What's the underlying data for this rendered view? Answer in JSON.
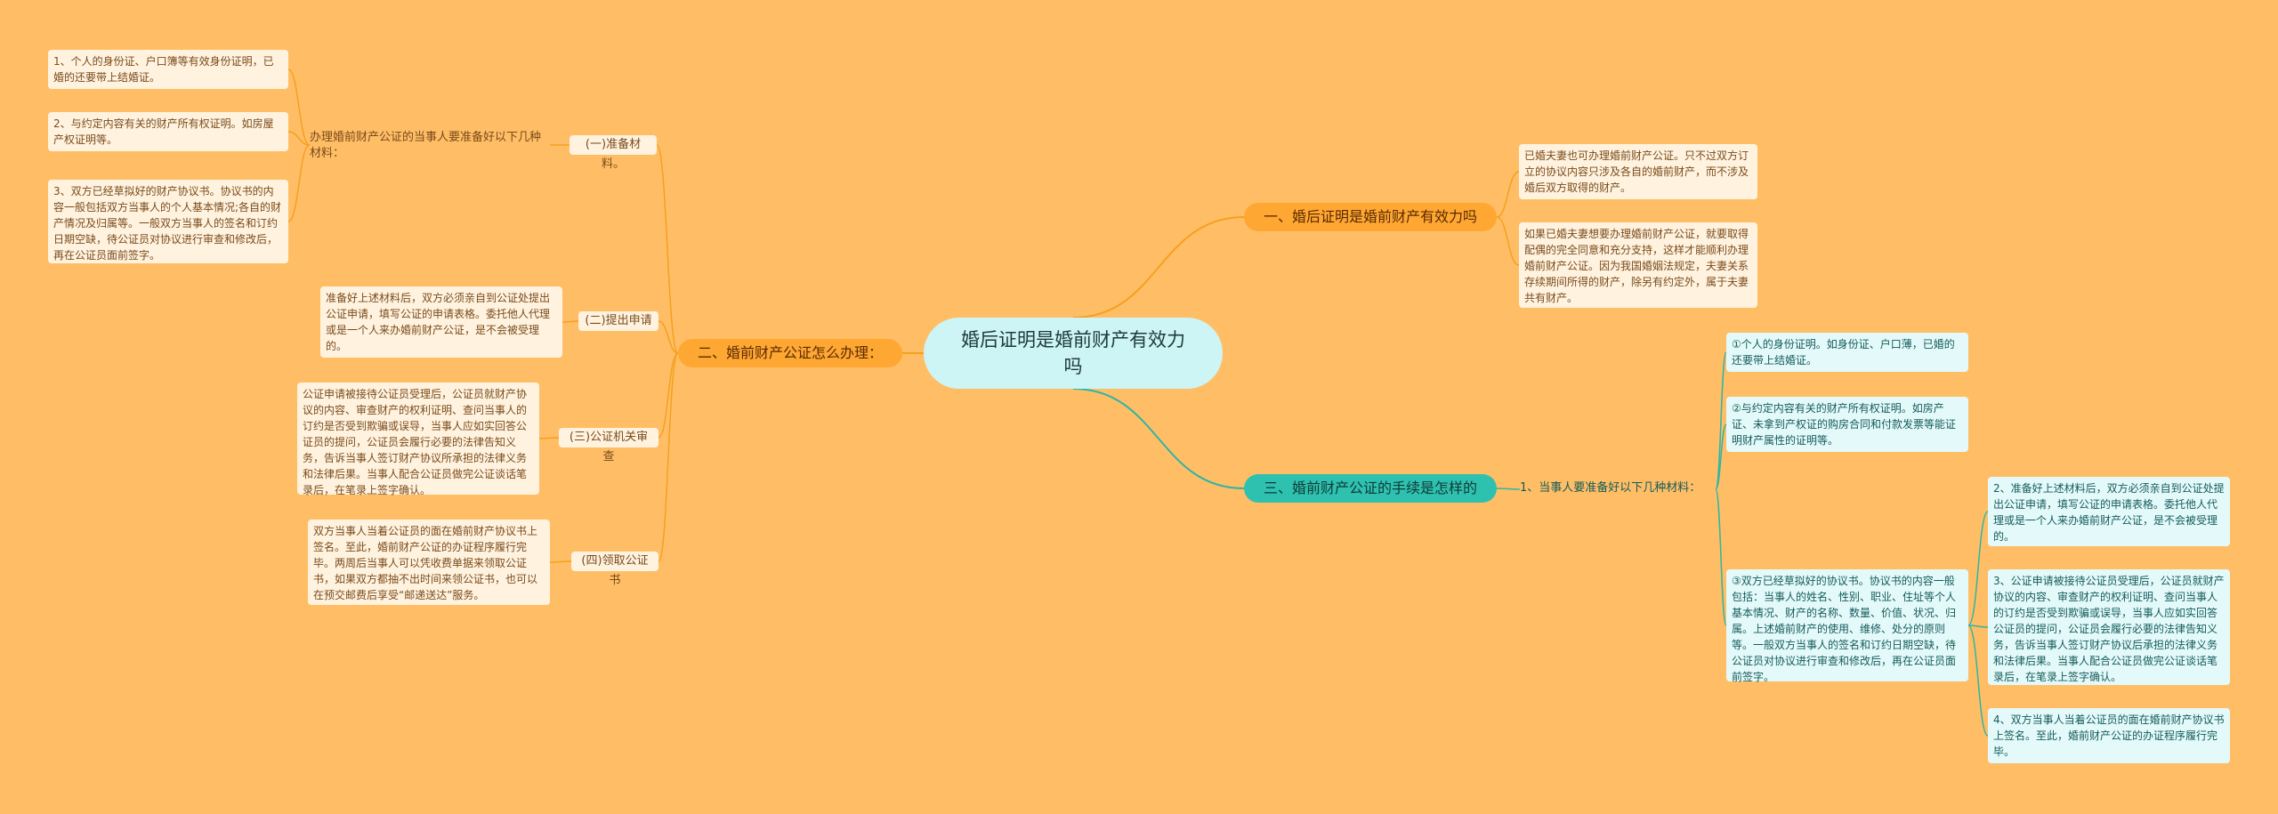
{
  "root": "婚后证明是婚前财产有效力吗",
  "branches": {
    "b1": "一、婚后证明是婚前财产有效力吗",
    "b2": "二、婚前财产公证怎么办理：",
    "b3": "三、婚前财产公证的手续是怎样的"
  },
  "b1_leaves": [
    "已婚夫妻也可办理婚前财产公证。只不过双方订立的协议内容只涉及各自的婚前财产，而不涉及婚后双方取得的财产。",
    "如果已婚夫妻想要办理婚前财产公证，就要取得配偶的完全同意和充分支持，这样才能顺利办理婚前财产公证。因为我国婚姻法规定，夫妻关系存续期间所得的财产，除另有约定外，属于夫妻共有财产。"
  ],
  "b2": {
    "sub1": "(一)准备材料。",
    "sub1_label": "办理婚前财产公证的当事人要准备好以下几种材料：",
    "sub1_items": [
      "1、个人的身份证、户口簿等有效身份证明，已婚的还要带上结婚证。",
      "2、与约定内容有关的财产所有权证明。如房屋产权证明等。",
      "3、双方已经草拟好的财产协议书。协议书的内容一般包括双方当事人的个人基本情况;各自的财产情况及归属等。一般双方当事人的签名和订约日期空缺，待公证员对协议进行审查和修改后，再在公证员面前签字。"
    ],
    "sub2": "(二)提出申请",
    "sub2_leaf": "准备好上述材料后，双方必须亲自到公证处提出公证申请，填写公证的申请表格。委托他人代理或是一个人来办婚前财产公证，是不会被受理的。",
    "sub3": "(三)公证机关审查",
    "sub3_leaf": "公证申请被接待公证员受理后，公证员就财产协议的内容、审查财产的权利证明、查问当事人的订约是否受到欺骗或误导，当事人应如实回答公证员的提问，公证员会履行必要的法律告知义务，告诉当事人签订财产协议所承担的法律义务和法律后果。当事人配合公证员做完公证谈话笔录后，在笔录上签字确认。",
    "sub4": "(四)领取公证书",
    "sub4_leaf": "双方当事人当着公证员的面在婚前财产协议书上签名。至此，婚前财产公证的办证程序履行完毕。两周后当事人可以凭收费单据来领取公证书，如果双方都抽不出时间来领公证书，也可以在预交邮费后享受“邮递送达”服务。"
  },
  "b3": {
    "sub": "1、当事人要准备好以下几种材料：",
    "items": [
      "①个人的身份证明。如身份证、户口薄，已婚的还要带上结婚证。",
      "②与约定内容有关的财产所有权证明。如房产证、未拿到产权证的购房合同和付款发票等能证明财产属性的证明等。",
      "③双方已经草拟好的协议书。协议书的内容一般包括：当事人的姓名、性别、职业、住址等个人基本情况、财产的名称、数量、价值、状况、归属。上述婚前财产的使用、维修、处分的原则等。一般双方当事人的签名和订约日期空缺，待公证员对协议进行审查和修改后，再在公证员面前签字。"
    ],
    "steps": [
      "2、准备好上述材料后，双方必须亲自到公证处提出公证申请，填写公证的申请表格。委托他人代理或是一个人来办婚前财产公证，是不会被受理的。",
      "3、公证申请被接待公证员受理后，公证员就财产协议的内容、审查财产的权利证明、查问当事人的订约是否受到欺骗或误导，当事人应如实回答公证员的提问，公证员会履行必要的法律告知义务，告诉当事人签订财产协议后承担的法律义务和法律后果。当事人配合公证员做完公证谈话笔录后，在笔录上签字确认。",
      "4、双方当事人当着公证员的面在婚前财产协议书上签名。至此，婚前财产公证的办证程序履行完毕。"
    ]
  },
  "colors": {
    "background": "#ffbe66",
    "orange_branch": "#ffa733",
    "teal_branch": "#2fc1b0",
    "root": "#cdf5f5"
  }
}
